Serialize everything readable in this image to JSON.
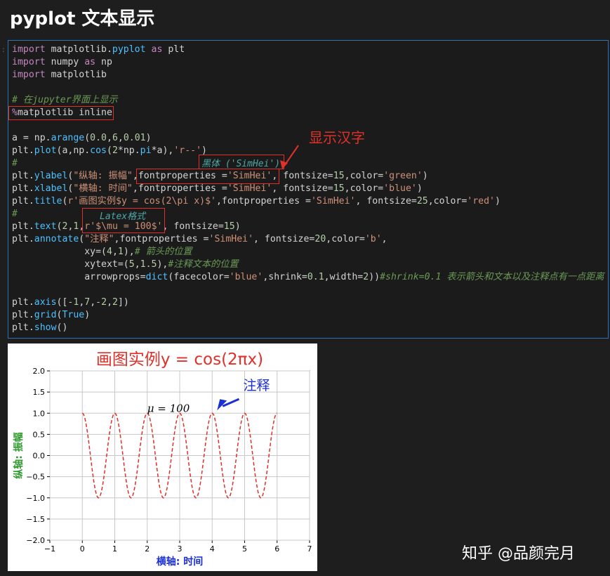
{
  "page": {
    "title": "pyplot 文本显示"
  },
  "code_lines": [
    [
      [
        "kw",
        "import"
      ],
      [
        "plain",
        " matplotlib."
      ],
      [
        "fn",
        "pyplot"
      ],
      [
        "kw",
        " as"
      ],
      [
        "plain",
        " plt"
      ]
    ],
    [
      [
        "kw",
        "import"
      ],
      [
        "plain",
        " numpy "
      ],
      [
        "kw",
        "as"
      ],
      [
        "plain",
        " np"
      ]
    ],
    [
      [
        "kw",
        "import"
      ],
      [
        "plain",
        " matplotlib"
      ]
    ],
    [],
    [
      [
        "cm",
        "# 在jupyter界面上显示"
      ]
    ],
    [
      [
        "mag",
        "%"
      ],
      [
        "plain",
        "matplotlib inline"
      ]
    ],
    [],
    [
      [
        "plain",
        "a = np."
      ],
      [
        "fn",
        "arange"
      ],
      [
        "plain",
        "("
      ],
      [
        "num",
        "0.0"
      ],
      [
        "plain",
        ","
      ],
      [
        "num",
        "6"
      ],
      [
        "plain",
        ","
      ],
      [
        "num",
        "0.01"
      ],
      [
        "plain",
        ")"
      ]
    ],
    [
      [
        "plain",
        "plt."
      ],
      [
        "fn",
        "plot"
      ],
      [
        "plain",
        "(a,np."
      ],
      [
        "fn",
        "cos"
      ],
      [
        "plain",
        "("
      ],
      [
        "num",
        "2"
      ],
      [
        "plain",
        "*np."
      ],
      [
        "fn",
        "pi"
      ],
      [
        "plain",
        "*a),"
      ],
      [
        "str",
        "'r--'"
      ],
      [
        "plain",
        ")"
      ]
    ],
    [
      [
        "cm",
        "#"
      ]
    ],
    [
      [
        "plain",
        "plt."
      ],
      [
        "fn",
        "ylabel"
      ],
      [
        "plain",
        "("
      ],
      [
        "str",
        "\"纵轴: 振幅\""
      ],
      [
        "plain",
        ",fontproperties ="
      ],
      [
        "str",
        "'SimHei'"
      ],
      [
        "plain",
        ", fontsize="
      ],
      [
        "num",
        "15"
      ],
      [
        "plain",
        ",color="
      ],
      [
        "str",
        "'green'"
      ],
      [
        "plain",
        ")"
      ]
    ],
    [
      [
        "plain",
        "plt."
      ],
      [
        "fn",
        "xlabel"
      ],
      [
        "plain",
        "("
      ],
      [
        "str",
        "\"横轴: 时间\""
      ],
      [
        "plain",
        ",fontproperties ="
      ],
      [
        "str",
        "'SimHei'"
      ],
      [
        "plain",
        ", fontsize="
      ],
      [
        "num",
        "15"
      ],
      [
        "plain",
        ",color="
      ],
      [
        "str",
        "'blue'"
      ],
      [
        "plain",
        ")"
      ]
    ],
    [
      [
        "plain",
        "plt."
      ],
      [
        "fn",
        "title"
      ],
      [
        "plain",
        "("
      ],
      [
        "str",
        "r'画图实例$y = cos(2\\pi x)$'"
      ],
      [
        "plain",
        ",fontproperties ="
      ],
      [
        "str",
        "'SimHei'"
      ],
      [
        "plain",
        ", fontsize="
      ],
      [
        "num",
        "25"
      ],
      [
        "plain",
        ",color="
      ],
      [
        "str",
        "'red'"
      ],
      [
        "plain",
        ")"
      ]
    ],
    [
      [
        "cm",
        "#"
      ]
    ],
    [
      [
        "plain",
        "plt."
      ],
      [
        "fn",
        "text"
      ],
      [
        "plain",
        "("
      ],
      [
        "num",
        "2"
      ],
      [
        "plain",
        ","
      ],
      [
        "num",
        "1"
      ],
      [
        "plain",
        ","
      ],
      [
        "str",
        "r'$\\mu = 100$'"
      ],
      [
        "plain",
        ", fontsize="
      ],
      [
        "num",
        "15"
      ],
      [
        "plain",
        ")"
      ]
    ],
    [
      [
        "plain",
        "plt."
      ],
      [
        "fn",
        "annotate"
      ],
      [
        "plain",
        "("
      ],
      [
        "str",
        "\"注释\""
      ],
      [
        "plain",
        ",fontproperties ="
      ],
      [
        "str",
        "'SimHei'"
      ],
      [
        "plain",
        ", fontsize="
      ],
      [
        "num",
        "20"
      ],
      [
        "plain",
        ",color="
      ],
      [
        "str",
        "'b'"
      ],
      [
        "plain",
        ","
      ]
    ],
    [
      [
        "plain",
        "             xy=("
      ],
      [
        "num",
        "4"
      ],
      [
        "plain",
        ","
      ],
      [
        "num",
        "1"
      ],
      [
        "plain",
        "),"
      ],
      [
        "cm",
        "# 箭头的位置"
      ]
    ],
    [
      [
        "plain",
        "             xytext=("
      ],
      [
        "num",
        "5"
      ],
      [
        "plain",
        ","
      ],
      [
        "num",
        "1.5"
      ],
      [
        "plain",
        "),"
      ],
      [
        "cm",
        "#注释文本的位置"
      ]
    ],
    [
      [
        "plain",
        "             arrowprops="
      ],
      [
        "fn",
        "dict"
      ],
      [
        "plain",
        "(facecolor="
      ],
      [
        "str",
        "'blue'"
      ],
      [
        "plain",
        ",shrink="
      ],
      [
        "num",
        "0.1"
      ],
      [
        "plain",
        ",width="
      ],
      [
        "num",
        "2"
      ],
      [
        "plain",
        "))"
      ],
      [
        "cm",
        "#shrink=0.1 表示箭头和文本以及注释点有一点距离"
      ]
    ],
    [],
    [
      [
        "plain",
        "plt."
      ],
      [
        "fn",
        "axis"
      ],
      [
        "plain",
        "(["
      ],
      [
        "num",
        "-1"
      ],
      [
        "plain",
        ","
      ],
      [
        "num",
        "7"
      ],
      [
        "plain",
        ","
      ],
      [
        "num",
        "-2"
      ],
      [
        "plain",
        ","
      ],
      [
        "num",
        "2"
      ],
      [
        "plain",
        "])"
      ]
    ],
    [
      [
        "plain",
        "plt."
      ],
      [
        "fn",
        "grid"
      ],
      [
        "plain",
        "("
      ],
      [
        "fn",
        "True"
      ],
      [
        "plain",
        ")"
      ]
    ],
    [
      [
        "plain",
        "plt."
      ],
      [
        "fn",
        "show"
      ],
      [
        "plain",
        "()"
      ]
    ]
  ],
  "notes": {
    "simhei": "黑体 ('SimHei')",
    "latex": "Latex格式",
    "show_chinese": "显示汉字"
  },
  "watermark": "知乎 @品颜完月",
  "chart_data": {
    "type": "line",
    "title": "画图实例y = cos(2πx)",
    "xlabel": "横轴: 时间",
    "ylabel": "纵轴: 振幅",
    "xlim": [
      -1,
      7
    ],
    "ylim": [
      -2,
      2
    ],
    "xticks": [
      "−1",
      "0",
      "1",
      "2",
      "3",
      "4",
      "5",
      "6",
      "7"
    ],
    "yticks": [
      "−2.0",
      "−1.5",
      "−1.0",
      "−0.5",
      "0.0",
      "0.5",
      "1.0",
      "1.5",
      "2.0"
    ],
    "grid": true,
    "series": [
      {
        "function": "cos(2*pi*x)",
        "x_range": [
          0.0,
          6.0
        ],
        "style": "dashed",
        "color": "#e0302a"
      }
    ],
    "text_annotation": {
      "text": "μ = 100",
      "x": 2,
      "y": 1
    },
    "arrow_annotation": {
      "text": "注释",
      "xy": [
        4,
        1
      ],
      "xytext": [
        5,
        1.5
      ],
      "color": "#1a2fd6"
    },
    "colors": {
      "title": "#e0302a",
      "xlabel": "#1a2fd6",
      "ylabel": "#2e9a2e",
      "line": "#e0302a"
    }
  }
}
